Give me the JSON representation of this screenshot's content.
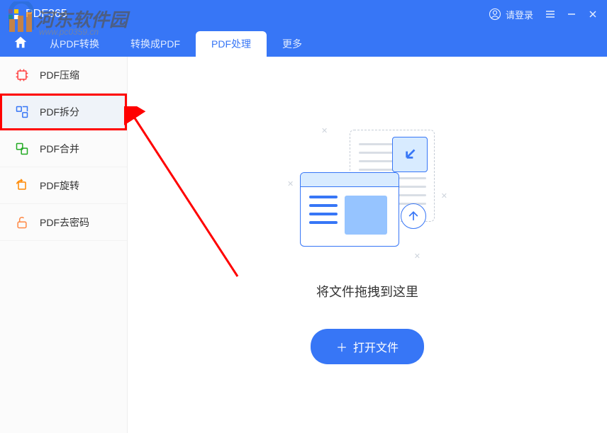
{
  "app": {
    "name": "PDF365"
  },
  "titlebar": {
    "login": "请登录"
  },
  "tabs": {
    "from_pdf": "从PDF转换",
    "to_pdf": "转换成PDF",
    "process": "PDF处理",
    "more": "更多"
  },
  "sidebar": {
    "items": [
      {
        "label": "PDF压缩",
        "icon": "compress",
        "color": "#ff4444"
      },
      {
        "label": "PDF拆分",
        "icon": "split",
        "color": "#3776f6"
      },
      {
        "label": "PDF合并",
        "icon": "merge",
        "color": "#22aa22"
      },
      {
        "label": "PDF旋转",
        "icon": "rotate",
        "color": "#ff8800"
      },
      {
        "label": "PDF去密码",
        "icon": "unlock",
        "color": "#ff8844"
      }
    ]
  },
  "main": {
    "drop_text": "将文件拖拽到这里",
    "open_button": "打开文件"
  },
  "watermark": {
    "text": "河东软件园",
    "url": "www.pc0359.cn"
  }
}
